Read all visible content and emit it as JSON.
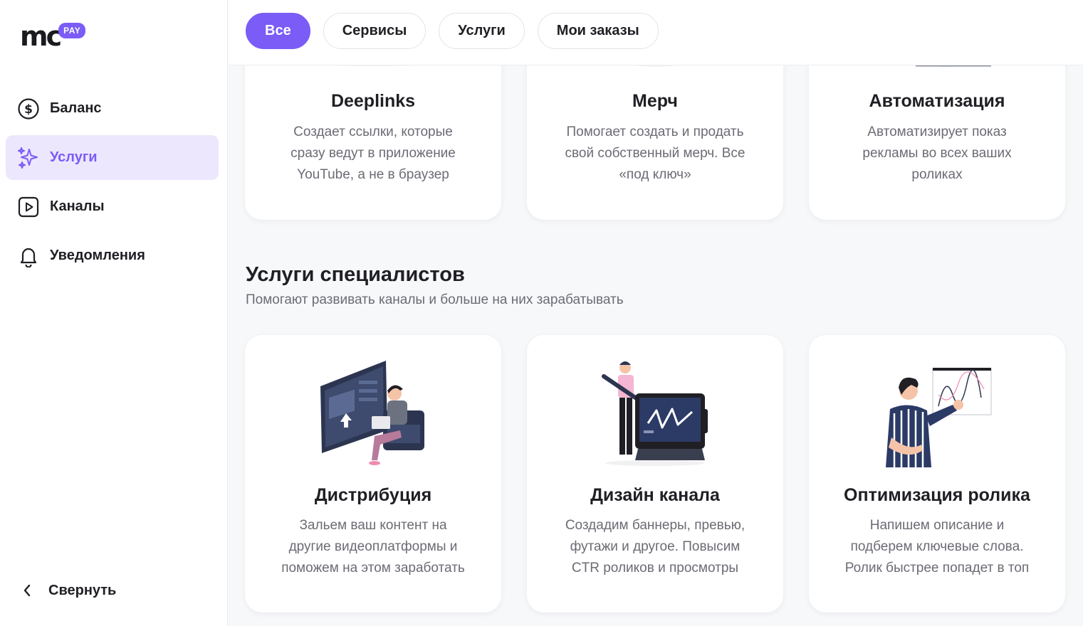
{
  "brand": {
    "logo_text": "mc",
    "badge": "PAY",
    "accent": "#7b5cf6"
  },
  "sidebar": {
    "items": [
      {
        "label": "Баланс",
        "icon": "dollar-circle-icon",
        "active": false
      },
      {
        "label": "Услуги",
        "icon": "sparkles-icon",
        "active": true
      },
      {
        "label": "Каналы",
        "icon": "play-square-icon",
        "active": false
      },
      {
        "label": "Уведомления",
        "icon": "bell-icon",
        "active": false
      }
    ],
    "collapse_label": "Свернуть"
  },
  "filters": [
    {
      "label": "Все",
      "active": true
    },
    {
      "label": "Сервисы",
      "active": false
    },
    {
      "label": "Услуги",
      "active": false
    },
    {
      "label": "Мои заказы",
      "active": false
    }
  ],
  "top_cards": [
    {
      "title": "Deeplinks",
      "desc": [
        "Создает ссылки, которые",
        "сразу ведут в приложение",
        "YouTube, а не в браузер"
      ]
    },
    {
      "title": "Мерч",
      "desc": [
        "Помогает создать и продать",
        "свой собственный мерч. Все",
        "«под ключ»"
      ]
    },
    {
      "title": "Автоматизация",
      "desc": [
        "Автоматизирует показ",
        "рекламы во всех ваших",
        "роликах"
      ]
    }
  ],
  "section": {
    "title": "Услуги специалистов",
    "subtitle": "Помогают развивать каналы и больше на них зарабатывать"
  },
  "specialist_cards": [
    {
      "title": "Дистрибуция",
      "desc": [
        "Зальем ваш контент на",
        "другие видеоплатформы и",
        "поможем на этом заработать"
      ]
    },
    {
      "title": "Дизайн канала",
      "desc": [
        "Создадим баннеры, превью,",
        "футажи и другое. Повысим",
        "CTR роликов и просмотры"
      ]
    },
    {
      "title": "Оптимизация ролика",
      "desc": [
        "Напишем описание и",
        "подберем ключевые слова.",
        "Ролик быстрее попадет в топ"
      ]
    }
  ]
}
